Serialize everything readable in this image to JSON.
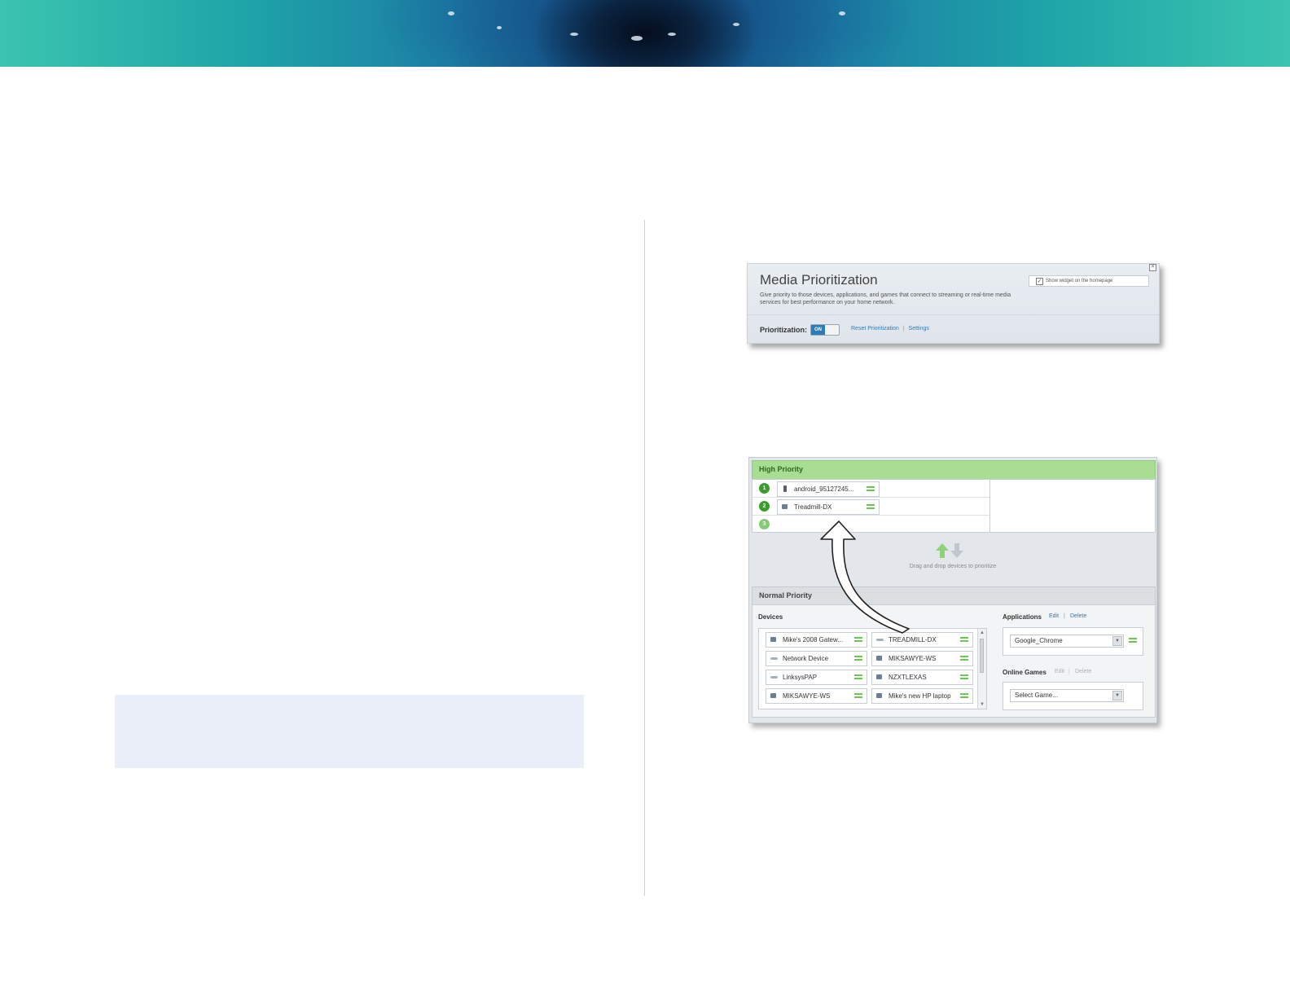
{
  "widget1": {
    "title": "Media Prioritization",
    "description": "Give priority to those devices, applications, and games that connect to streaming or real-time media services for best performance on your home network.",
    "show_widget_label": "Show widget on the homepage",
    "show_widget_checked": true,
    "prioritization_label": "Prioritization:",
    "toggle_label": "ON",
    "reset_link": "Reset Prioritization",
    "link_separator": "|",
    "settings_link": "Settings"
  },
  "widget2": {
    "high_priority_title": "High Priority",
    "high_priority_items": [
      {
        "num": "1",
        "name": "android_95127245...",
        "icon": "phone-icon"
      },
      {
        "num": "2",
        "name": "Treadmill-DX",
        "icon": "computer-icon"
      },
      {
        "num": "3",
        "name": "",
        "icon": ""
      }
    ],
    "drag_hint": "Drag and drop devices to prioritize",
    "normal_priority_title": "Normal Priority",
    "devices_label": "Devices",
    "devices": [
      {
        "name": "Mike's 2008 Gatew...",
        "icon": "computer-icon"
      },
      {
        "name": "TREADMILL-DX",
        "icon": "network-device-icon"
      },
      {
        "name": "Network Device",
        "icon": "network-device-icon"
      },
      {
        "name": "MIKSAWYE-WS",
        "icon": "computer-icon"
      },
      {
        "name": "LinksysPAP",
        "icon": "network-device-icon"
      },
      {
        "name": "NZXTLEXAS",
        "icon": "computer-icon"
      },
      {
        "name": "MIKSAWYE-WS",
        "icon": "computer-icon"
      },
      {
        "name": "Mike's new HP laptop",
        "icon": "computer-icon"
      }
    ],
    "applications_label": "Applications",
    "applications_edit": "Edit",
    "applications_delete": "Delete",
    "link_separator": "|",
    "application_selected": "Google_Chrome",
    "online_games_label": "Online Games",
    "games_edit": "Edit",
    "games_delete": "Delete",
    "game_select_placeholder": "Select Game..."
  }
}
